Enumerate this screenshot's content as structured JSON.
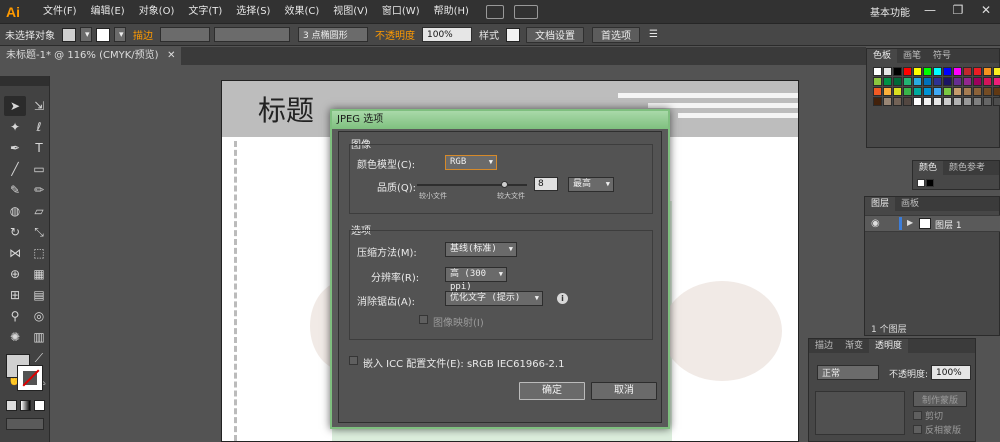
{
  "app": {
    "logo": "Ai",
    "workspace": "基本功能"
  },
  "menu": [
    "文件(F)",
    "编辑(E)",
    "对象(O)",
    "文字(T)",
    "选择(S)",
    "效果(C)",
    "视图(V)",
    "窗口(W)",
    "帮助(H)"
  ],
  "window_buttons": [
    "—",
    "❐",
    "✕"
  ],
  "control_bar": {
    "selection": "未选择对象",
    "stroke_label": "描边",
    "brush": "3 点椭圆形",
    "opacity_label": "不透明度",
    "opacity_value": "100%",
    "style_label": "样式",
    "doc_setup": "文档设置",
    "prefs": "首选项"
  },
  "doc_tab": {
    "title": "未标题-1* @ 116% (CMYK/预览)",
    "close": "✕"
  },
  "artboard": {
    "title": "标题"
  },
  "dialog": {
    "title": "JPEG 选项",
    "image_group": "图像",
    "color_model_label": "颜色模型(C):",
    "color_model_value": "RGB",
    "quality_label": "品质(Q):",
    "quality_small": "较小文件",
    "quality_large": "较大文件",
    "quality_value": "8",
    "quality_preset": "最高",
    "quality_fraction": 0.8,
    "options_group": "选项",
    "compression_label": "压缩方法(M):",
    "compression_value": "基线(标准)",
    "resolution_label": "分辨率(R):",
    "resolution_value": "高 (300 ppi)",
    "antialias_label": "消除锯齿(A):",
    "antialias_value": "优化文字 (提示)",
    "imagemap_label": "图像映射(I)",
    "icc_label": "嵌入 ICC 配置文件(E): sRGB IEC61966-2.1",
    "ok": "确定",
    "cancel": "取消"
  },
  "panels": {
    "swatches_tabs": [
      "色板",
      "画笔",
      "符号"
    ],
    "color_tabs": [
      "颜色",
      "颜色参考"
    ],
    "layers_tabs": [
      "图层",
      "画板"
    ],
    "layer_name": "图层 1",
    "layers_count": "1 个图层",
    "transparency_tabs": [
      "描边",
      "渐变",
      "透明度"
    ],
    "blend_mode": "正常",
    "opacity_label": "不透明度:",
    "opacity_value": "100%",
    "make_mask": "制作蒙版",
    "clip": "剪切",
    "invert_mask": "反相蒙版"
  },
  "colors": {
    "accent": "#ff9a00",
    "dialog_border": "#7fbf7f",
    "dialog_title": "#a9d9a9"
  }
}
